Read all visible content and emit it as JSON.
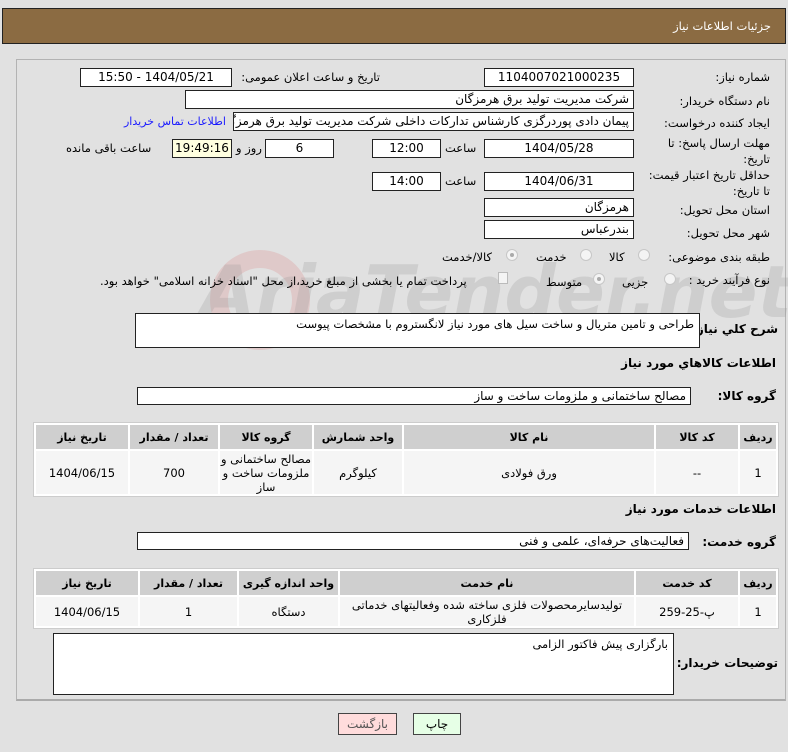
{
  "header": {
    "title": "جزئیات اطلاعات نیاز"
  },
  "form": {
    "need_number_label": "شماره نیاز:",
    "need_number": "1104007021000235",
    "announce_label": "تاریخ و ساعت اعلان عمومی:",
    "announce_value": "1404/05/21 - 15:50",
    "buyer_label": "نام دستگاه خریدار:",
    "buyer_value": "شرکت مدیریت تولید برق هرمزگان",
    "creator_label": "ایجاد کننده درخواست:",
    "creator_value": "پیمان دادی پوردرگزی کارشناس تدارکات داخلی شرکت مدیریت تولید برق هرمزگا",
    "contact_link": "اطلاعات تماس خریدار",
    "deadline_label_1": "مهلت ارسال پاسخ: تا",
    "deadline_label_2": "تاریخ:",
    "deadline_date": "1404/05/28",
    "time_label": "ساعت",
    "deadline_time": "12:00",
    "days": "6",
    "days_label": "روز و",
    "remaining": "19:49:16",
    "remaining_label": "ساعت باقی مانده",
    "validity_label_1": "حداقل تاریخ اعتبار قیمت:",
    "validity_label_2": "تا تاریخ:",
    "validity_date": "1404/06/31",
    "validity_time": "14:00",
    "province_label": "استان محل تحویل:",
    "province_value": "هرمزگان",
    "city_label": "شهر محل تحویل:",
    "city_value": "بندرعباس",
    "category_label": "طبقه بندی موضوعی:",
    "category_options": [
      "کالا",
      "خدمت",
      "کالا/خدمت"
    ],
    "process_label": "نوع فرآیند خرید :",
    "process_options": [
      "جزیی",
      "متوسط"
    ],
    "payment_note": "پرداخت تمام یا بخشی از مبلغ خرید،از محل \"اسناد خزانه اسلامی\" خواهد بود.",
    "description_label": "شرح کلي نياز:",
    "description_value": "طراحی و تامین متریال و ساخت سیل های مورد نیاز لانگستروم با مشخصات پیوست"
  },
  "goods": {
    "heading": "اطلاعات کالاهاي مورد نياز",
    "group_label": "گروه کالا:",
    "group_value": "مصالح ساختمانی و ملزومات ساخت و ساز",
    "columns": [
      "ردیف",
      "کد کالا",
      "نام کالا",
      "واحد شمارش",
      "گروه کالا",
      "تعداد / مقدار",
      "تاریخ نیاز"
    ],
    "rows": [
      [
        "1",
        "--",
        "ورق فولادی",
        "کیلوگرم",
        "مصالح ساختمانی و ملزومات ساخت و ساز",
        "700",
        "1404/06/15"
      ]
    ]
  },
  "services": {
    "heading": "اطلاعات خدمات مورد نیاز",
    "group_label": "گروه خدمت:",
    "group_value": "فعالیت‌های حرفه‌ای، علمی و فنی",
    "columns": [
      "ردیف",
      "کد خدمت",
      "نام خدمت",
      "واحد اندازه گیری",
      "تعداد / مقدار",
      "تاریخ نیاز"
    ],
    "rows": [
      [
        "1",
        "پ-25-259",
        "تولیدسایرمحصولات فلزی ساخته شده وفعالیتهای خدماتی فلزکاری",
        "دستگاه",
        "1",
        "1404/06/15"
      ]
    ]
  },
  "notes": {
    "label": "توضیحات خریدار:",
    "value": "بارگزاری پیش فاکتور الزامی"
  },
  "buttons": {
    "back": "بازگشت",
    "print": "چاپ"
  },
  "watermark": "AriaTender.net",
  "colors": {
    "header": "#8b6b42",
    "back_btn": "#ffdcdc",
    "print_btn": "#e6ffe6"
  }
}
